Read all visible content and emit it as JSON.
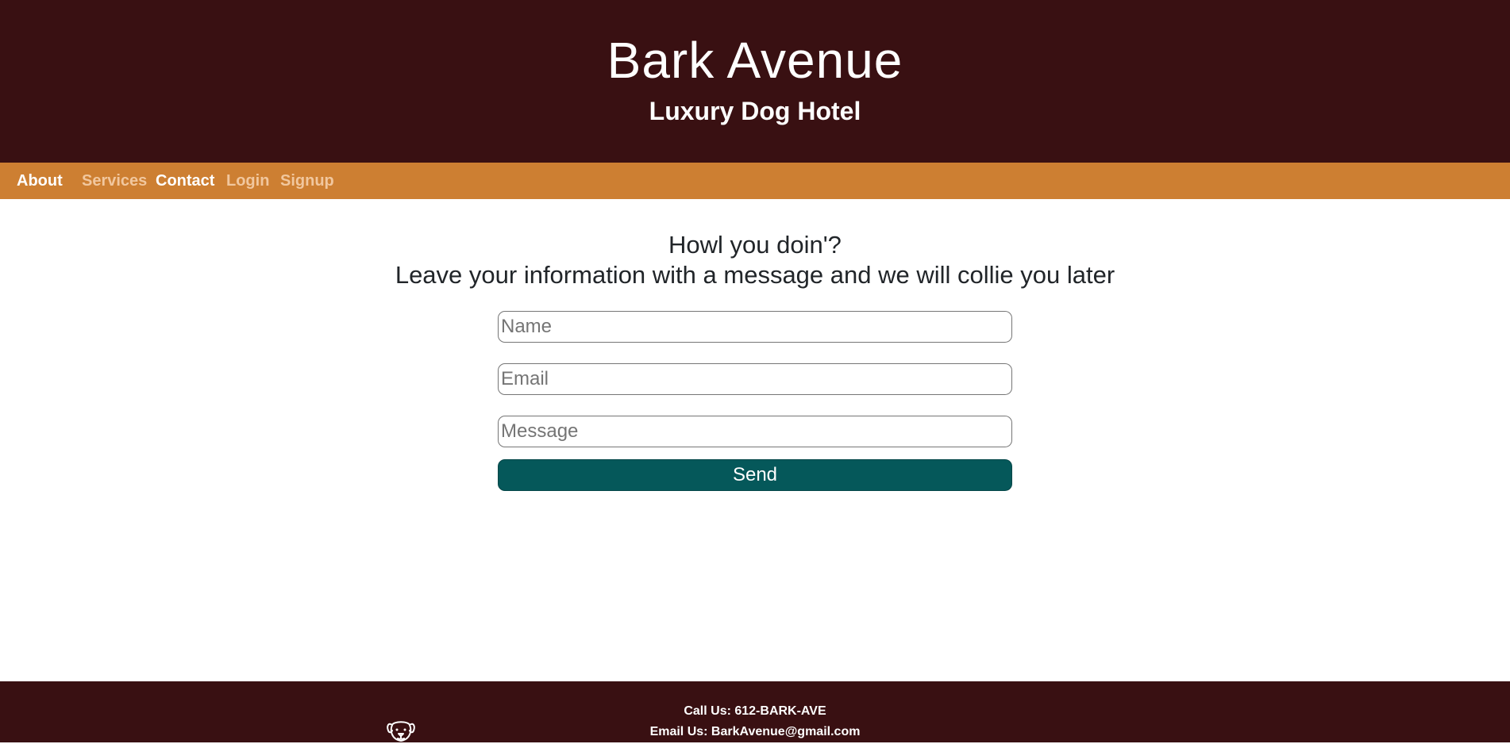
{
  "header": {
    "title": "Bark Avenue",
    "subtitle": "Luxury Dog Hotel"
  },
  "nav": {
    "about": "About",
    "services": "Services",
    "contact": "Contact",
    "login": "Login",
    "signup": "Signup"
  },
  "contact_form": {
    "heading_line1": "Howl you doin'?",
    "heading_line2": "Leave your information with a message and we will collie you later",
    "name_placeholder": "Name",
    "email_placeholder": "Email",
    "message_placeholder": "Message",
    "name_value": "",
    "email_value": "",
    "message_value": "",
    "send_label": "Send"
  },
  "footer": {
    "logo_icon": "dog-face-icon",
    "phone": "Call Us: 612-BARK-AVE",
    "email": "Email Us: BarkAvenue@gmail.com"
  },
  "colors": {
    "header_bg": "#391012",
    "nav_bg": "#cd7f32",
    "button_bg": "#05585a",
    "nav_muted": "#f1c79e"
  }
}
